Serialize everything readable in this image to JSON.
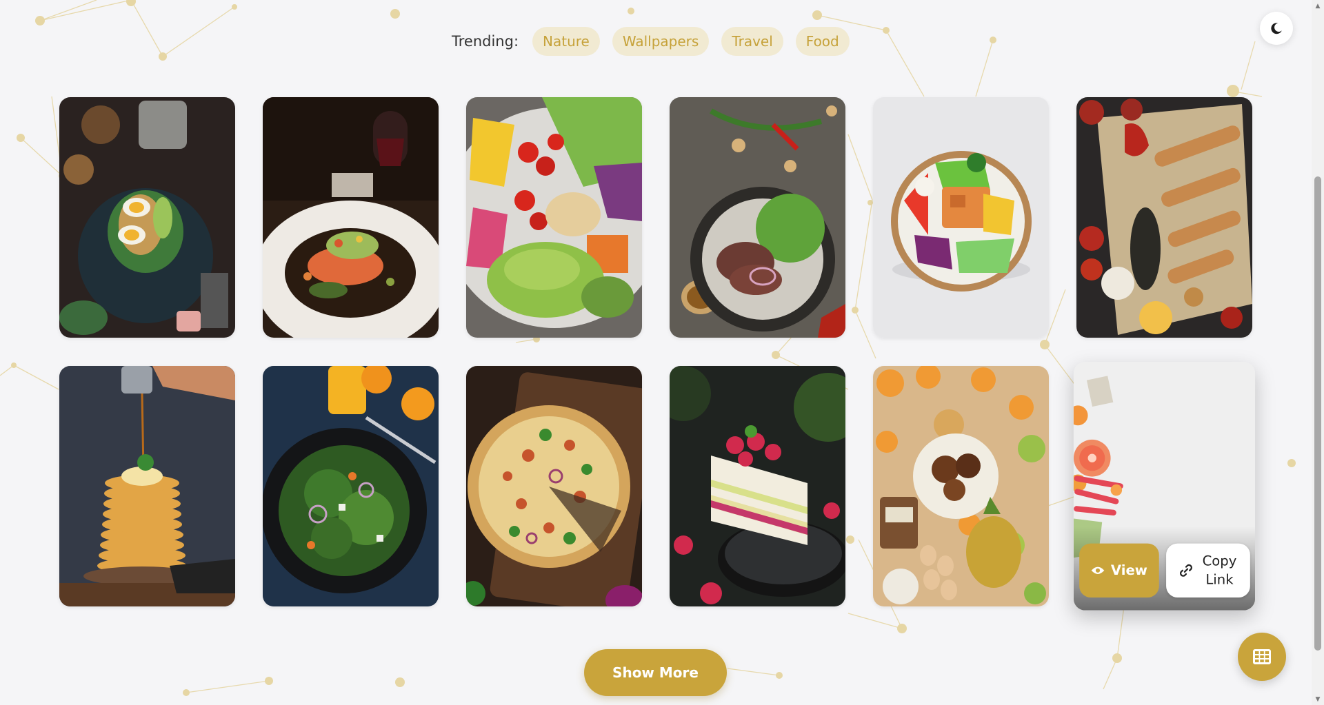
{
  "trending": {
    "label": "Trending:",
    "tags": [
      "Nature",
      "Wallpapers",
      "Travel",
      "Food"
    ]
  },
  "theme_toggle": {
    "icon": "moon-icon"
  },
  "gallery": {
    "images": [
      {
        "name": "egg-avocado-toast"
      },
      {
        "name": "salmon-fine-dining"
      },
      {
        "name": "veggie-buddha-bowl"
      },
      {
        "name": "steak-salad-bowl"
      },
      {
        "name": "salmon-poke-bowl"
      },
      {
        "name": "bbq-skewers-platter"
      },
      {
        "name": "pancakes-syrup"
      },
      {
        "name": "green-salad-orange-juice"
      },
      {
        "name": "pizza-board"
      },
      {
        "name": "raspberry-cake-slice"
      },
      {
        "name": "fruit-breakfast-spread"
      },
      {
        "name": "citrus-rhubarb-corner"
      }
    ],
    "hover_actions": {
      "view_label": "View",
      "copy_label": "Copy Link"
    }
  },
  "show_more_label": "Show More",
  "colors": {
    "accent": "#c9a43b",
    "tag_bg": "#f1ead2",
    "tag_text": "#c6a23a",
    "background": "#f5f5f7"
  }
}
